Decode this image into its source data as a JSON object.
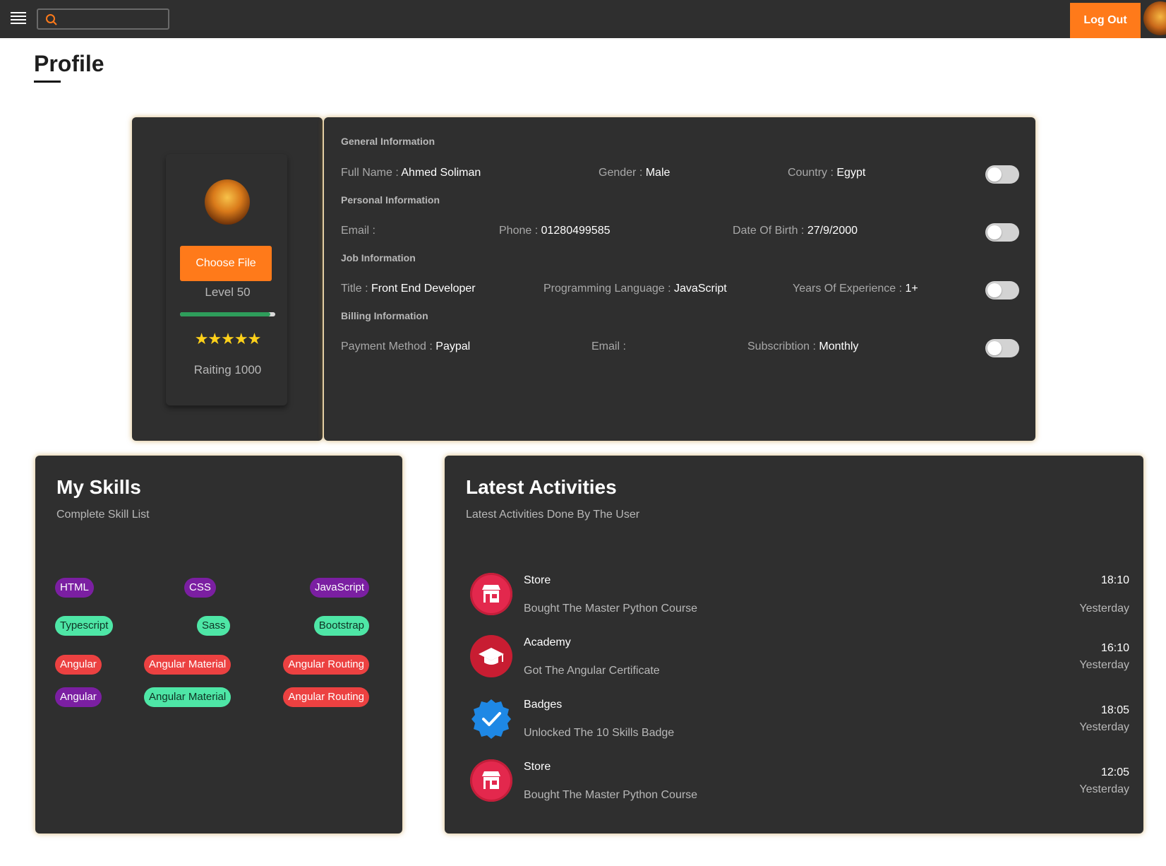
{
  "header": {
    "search_placeholder": "",
    "logout_label": "Log Out"
  },
  "page": {
    "title": "Profile"
  },
  "profile": {
    "choose_file_label": "Choose File",
    "level": "Level 50",
    "level_progress": 0.95,
    "stars": "★★★★★",
    "rating": "Raiting 1000"
  },
  "info": {
    "general": {
      "label": "General Information",
      "fields": [
        {
          "key": "Full Name",
          "value": "Ahmed Soliman"
        },
        {
          "key": "Gender",
          "value": "Male"
        },
        {
          "key": "Country",
          "value": "Egypt"
        }
      ]
    },
    "personal": {
      "label": "Personal Information",
      "fields": [
        {
          "key": "Email",
          "value": ""
        },
        {
          "key": "Phone",
          "value": "01280499585"
        },
        {
          "key": "Date Of Birth",
          "value": "27/9/2000"
        }
      ]
    },
    "job": {
      "label": "Job Information",
      "fields": [
        {
          "key": "Title",
          "value": "Front End Developer"
        },
        {
          "key": "Programming Language",
          "value": "JavaScript"
        },
        {
          "key": "Years Of Experience",
          "value": "1+"
        }
      ]
    },
    "billing": {
      "label": "Billing Information",
      "fields": [
        {
          "key": "Payment Method",
          "value": "Paypal"
        },
        {
          "key": "Email",
          "value": ""
        },
        {
          "key": "Subscribtion",
          "value": "Monthly"
        }
      ]
    }
  },
  "skills": {
    "title": "My Skills",
    "subtitle": "Complete Skill List",
    "rows": [
      [
        {
          "label": "HTML",
          "color": "#7b1fa2"
        },
        {
          "label": "CSS",
          "color": "#7b1fa2"
        },
        {
          "label": "JavaScript",
          "color": "#7b1fa2"
        }
      ],
      [
        {
          "label": "Typescript",
          "color": "#4ee6a6"
        },
        {
          "label": "Sass",
          "color": "#4ee6a6"
        },
        {
          "label": "Bootstrap",
          "color": "#4ee6a6"
        }
      ],
      [
        {
          "label": "Angular",
          "color": "#ec4141"
        },
        {
          "label": "Angular Material",
          "color": "#ec4141"
        },
        {
          "label": "Angular Routing",
          "color": "#ec4141"
        }
      ],
      [
        {
          "label": "Angular",
          "color": "#7b1fa2"
        },
        {
          "label": "Angular Material",
          "color": "#4ee6a6"
        },
        {
          "label": "Angular Routing",
          "color": "#ec4141"
        }
      ]
    ]
  },
  "activities": {
    "title": "Latest Activities",
    "subtitle": "Latest Activities Done By The User",
    "items": [
      {
        "icon": "store-icon",
        "title": "Store",
        "desc": "Bought The Master Python Course",
        "time": "18:10",
        "day": "Yesterday"
      },
      {
        "icon": "graduation-cap-icon",
        "title": "Academy",
        "desc": "Got The Angular Certificate",
        "time": "16:10",
        "day": "Yesterday"
      },
      {
        "icon": "verified-badge-icon",
        "title": "Badges",
        "desc": "Unlocked The 10 Skills Badge",
        "time": "18:05",
        "day": "Yesterday"
      },
      {
        "icon": "store-icon",
        "title": "Store",
        "desc": "Bought The Master Python Course",
        "time": "12:05",
        "day": "Yesterday"
      }
    ]
  },
  "colors": {
    "accent": "#ff7a1a",
    "card_bg": "#2f2f2f",
    "topbar_bg": "#2f2f2f"
  }
}
